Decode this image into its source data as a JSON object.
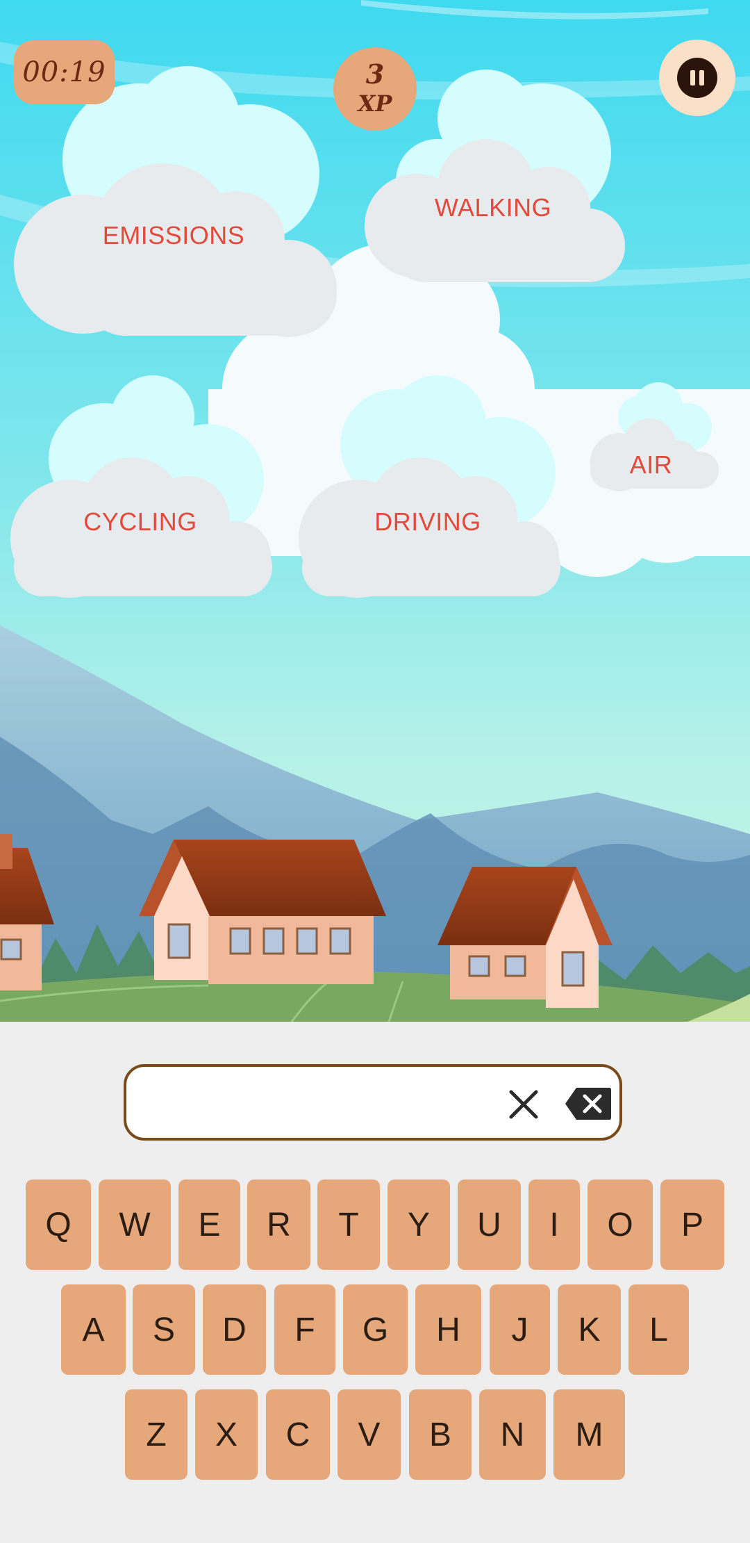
{
  "hud": {
    "timer": "00:19",
    "xp_value": "3",
    "xp_unit": "XP"
  },
  "words": [
    "EMISSIONS",
    "WALKING",
    "AIR",
    "CYCLING",
    "DRIVING"
  ],
  "input": {
    "value": ""
  },
  "keyboard": {
    "row1": [
      "Q",
      "W",
      "E",
      "R",
      "T",
      "Y",
      "U",
      "I",
      "O",
      "P"
    ],
    "row2": [
      "A",
      "S",
      "D",
      "F",
      "G",
      "H",
      "J",
      "K",
      "L"
    ],
    "row3": [
      "Z",
      "X",
      "C",
      "V",
      "B",
      "N",
      "M"
    ]
  },
  "colors": {
    "accent": "#e6a77b",
    "word_text": "#e14b3c",
    "input_border": "#7a4a1a",
    "sky_top": "#3fd9f0",
    "cloud": "#e8ebee"
  }
}
